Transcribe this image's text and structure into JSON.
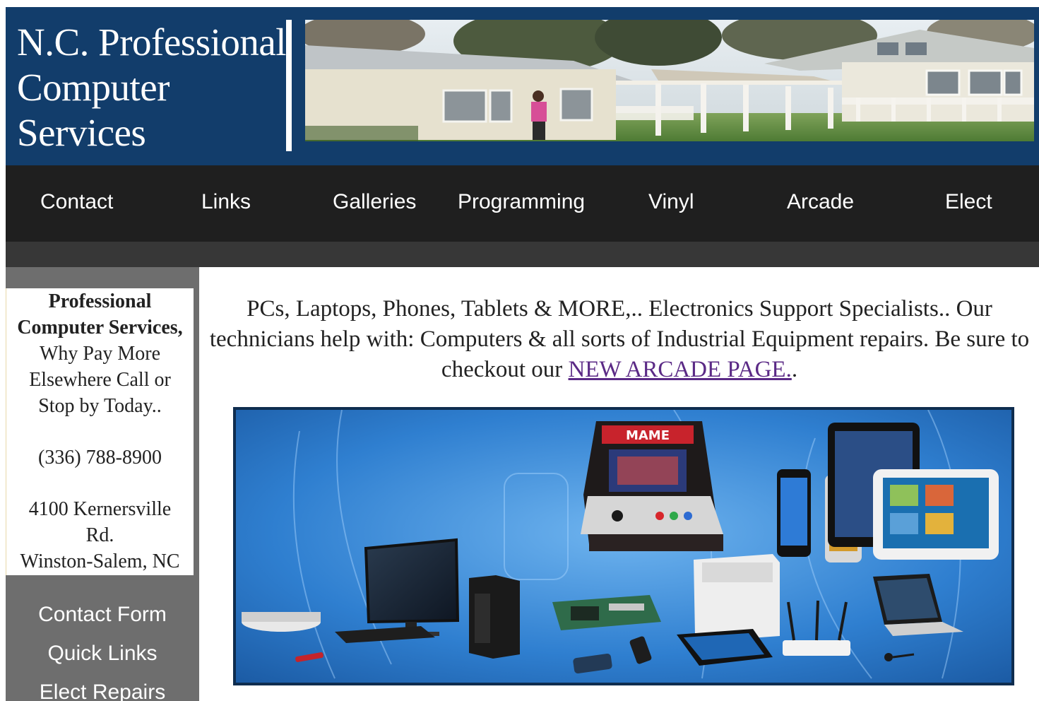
{
  "header": {
    "title_lines": [
      "N.C. Professional",
      "Computer",
      "Services"
    ],
    "photo_alt": "house-photo"
  },
  "nav": {
    "items": [
      "Contact",
      "Links",
      "Galleries",
      "Programming",
      "Vinyl",
      "Arcade",
      "Elect"
    ]
  },
  "sidebar": {
    "card": {
      "bold_lines": [
        "Professional",
        "Computer Services,"
      ],
      "tagline_lines": [
        "Why Pay More",
        "Elsewhere Call or",
        "Stop by Today.."
      ],
      "phone": "(336) 788-8900",
      "address_lines": [
        "4100 Kernersville",
        "Rd.",
        "Winston-Salem, NC"
      ]
    },
    "links": [
      "Contact Form",
      "Quick Links",
      "Elect Repairs"
    ]
  },
  "main": {
    "intro_before_link": "PCs, Laptops, Phones, Tablets & MORE,.. Electronics Support Specialists.. Our technicians help with: Computers & all sorts of Industrial Equipment repairs. Be sure to checkout our ",
    "intro_link": "NEW ARCADE PAGE.",
    "intro_after_link": ".",
    "hero_marquee": "MAME"
  },
  "colors": {
    "header_bg": "#123d6b",
    "nav_bg": "#1f1f1f",
    "subbar_bg": "#373737",
    "sidebar_bg": "#6e6e6e",
    "link_visited": "#5b2a86",
    "hero_blue": "#2f7fd0"
  }
}
